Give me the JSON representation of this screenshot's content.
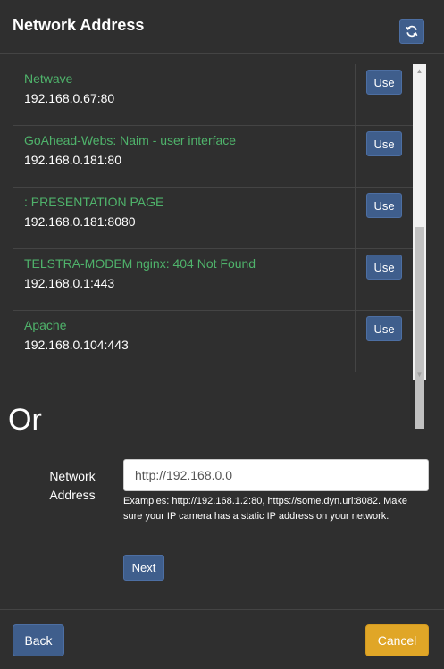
{
  "header": {
    "title": "Network Address",
    "refresh_icon": "refresh-icon"
  },
  "devices": [
    {
      "name": "Netwave",
      "address": "192.168.0.67:80",
      "use_label": "Use"
    },
    {
      "name": "GoAhead-Webs: Naim - user interface",
      "address": "192.168.0.181:80",
      "use_label": "Use"
    },
    {
      "name": ": PRESENTATION PAGE",
      "address": "192.168.0.181:8080",
      "use_label": "Use"
    },
    {
      "name": "TELSTRA-MODEM nginx: 404 Not Found",
      "address": "192.168.0.1:443",
      "use_label": "Use"
    },
    {
      "name": "Apache",
      "address": "192.168.0.104:443",
      "use_label": "Use"
    }
  ],
  "or_label": "Or",
  "form": {
    "label": "Network Address",
    "value": "http://192.168.0.0",
    "help": "Examples: http://192.168.1.2:80, https://some.dyn.url:8082. Make sure your IP camera has a static IP address on your network.",
    "next_label": "Next"
  },
  "footer": {
    "back_label": "Back",
    "cancel_label": "Cancel"
  },
  "colors": {
    "background": "#2f2f2f",
    "primary_button": "#3f5e8c",
    "cancel_button": "#e0a627",
    "device_name": "#4fb36b"
  }
}
